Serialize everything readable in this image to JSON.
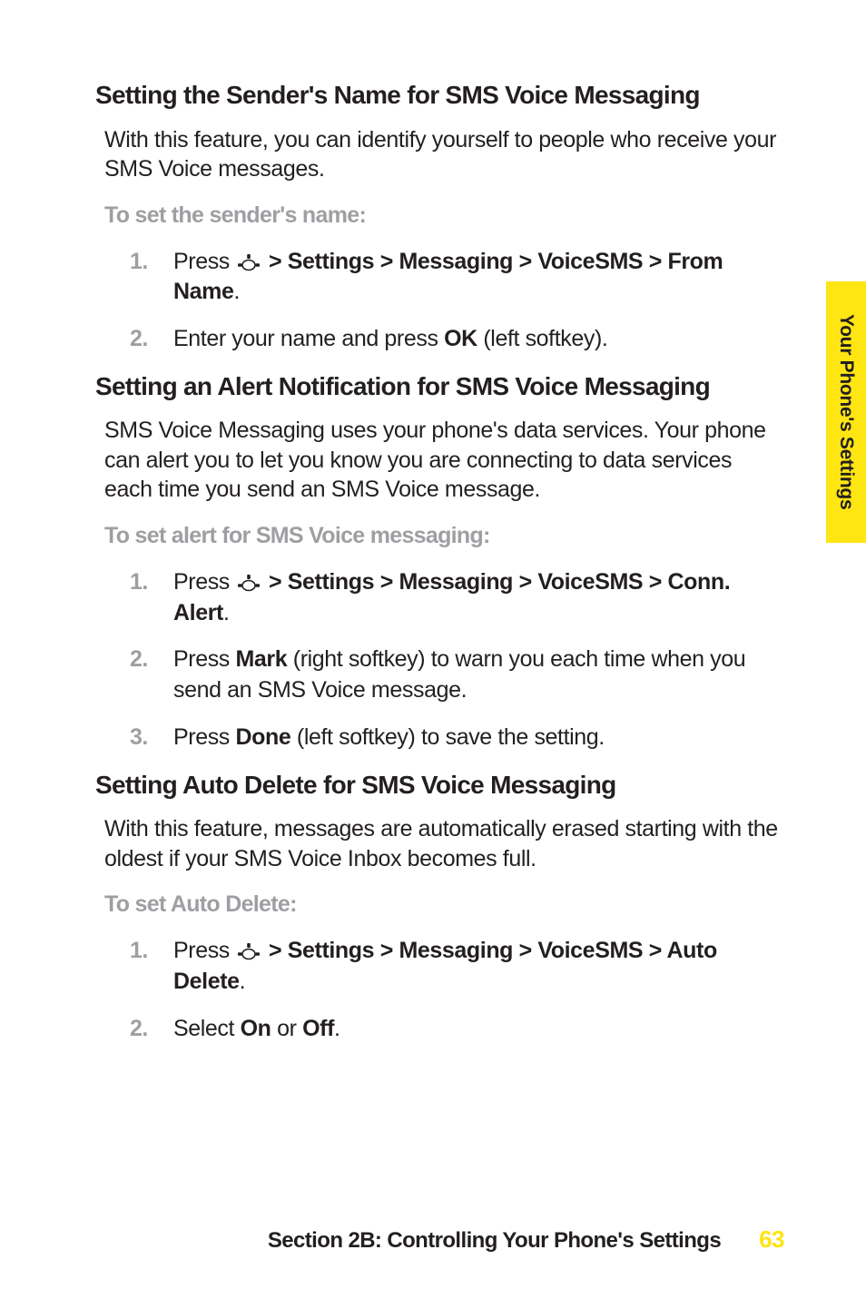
{
  "sideTab": "Your Phone's Settings",
  "sections": [
    {
      "heading": "Setting the Sender's Name for SMS Voice Messaging",
      "body": "With this feature, you can identify yourself to people who receive your SMS Voice messages.",
      "subHeading": "To set the sender's name:",
      "steps": [
        {
          "num": "1.",
          "pre": "Press ",
          "boldPath": " > Settings > Messaging > VoiceSMS > From Name",
          "post": "."
        },
        {
          "num": "2.",
          "textParts": [
            "Enter your name and press ",
            "OK",
            " (left softkey)."
          ]
        }
      ]
    },
    {
      "heading": "Setting an Alert Notification for SMS Voice Messaging",
      "body": "SMS Voice Messaging uses your phone's data services. Your phone can alert you to let you know you are connecting to data services each time you send an SMS Voice message.",
      "subHeading": "To set alert for SMS Voice messaging:",
      "steps": [
        {
          "num": "1.",
          "pre": "Press ",
          "boldPath": " > Settings > Messaging > VoiceSMS > Conn. Alert",
          "post": "."
        },
        {
          "num": "2.",
          "textParts": [
            "Press ",
            "Mark",
            " (right softkey) to warn you each time when you send an SMS Voice message."
          ]
        },
        {
          "num": "3.",
          "textParts": [
            "Press ",
            "Done",
            " (left softkey) to save the setting."
          ]
        }
      ]
    },
    {
      "heading": "Setting Auto Delete for SMS Voice Messaging",
      "body": "With this feature, messages are automatically erased starting with the oldest if your SMS Voice Inbox becomes full.",
      "subHeading": "To set Auto Delete:",
      "steps": [
        {
          "num": "1.",
          "pre": "Press ",
          "boldPath": " > Settings > Messaging > VoiceSMS > Auto Delete",
          "post": "."
        },
        {
          "num": "2.",
          "textParts": [
            "Select ",
            "On",
            " or ",
            "Off",
            "."
          ]
        }
      ]
    }
  ],
  "footer": {
    "title": "Section 2B: Controlling Your Phone's Settings",
    "pageNum": "63"
  }
}
